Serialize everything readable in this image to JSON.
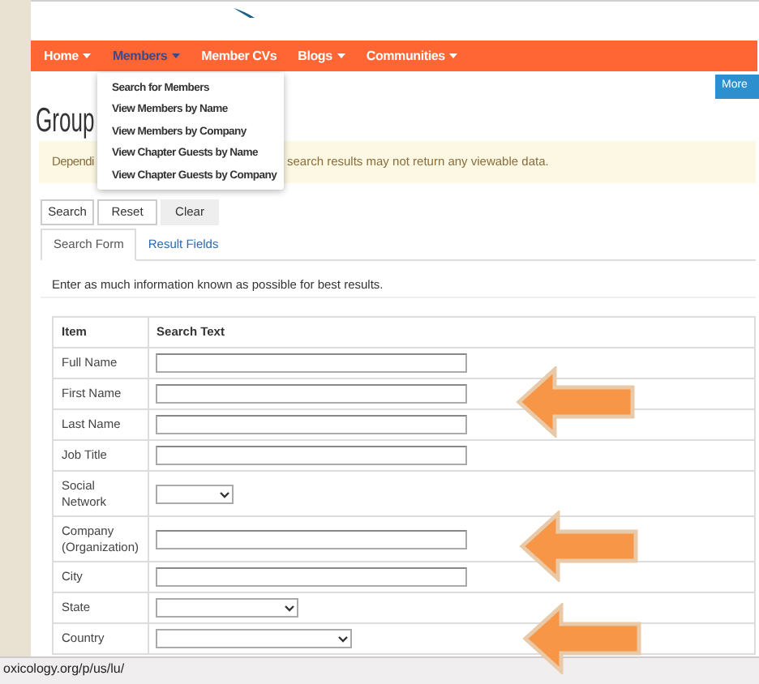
{
  "nav": {
    "items": [
      {
        "label": "Home",
        "caret": true,
        "selected": false
      },
      {
        "label": "Members",
        "caret": true,
        "selected": true
      },
      {
        "label": "Member CVs",
        "caret": false,
        "selected": false
      },
      {
        "label": "Blogs",
        "caret": true,
        "selected": false
      },
      {
        "label": "Communities",
        "caret": true,
        "selected": false
      }
    ]
  },
  "dropdown": {
    "items": [
      "Search for Members",
      "View Members by Name",
      "View Members by Company",
      "View Chapter Guests by Name",
      "View Chapter Guests by Company"
    ]
  },
  "more_button": "More",
  "heading": "Group",
  "alert": {
    "text_start": "Dependi",
    "text_end": "search results may not return any viewable data."
  },
  "buttons": [
    "Search",
    "Reset",
    "Clear"
  ],
  "tabs": [
    {
      "label": "Search Form",
      "selected": true
    },
    {
      "label": "Result Fields",
      "selected": false
    }
  ],
  "instructions": "Enter as much information known as possible for best results.",
  "table": {
    "columns": [
      "Item",
      "Search Text"
    ],
    "rows": [
      {
        "label": "Full Name",
        "kind": "text"
      },
      {
        "label": "First Name",
        "kind": "text"
      },
      {
        "label": "Last Name",
        "kind": "text"
      },
      {
        "label": "Job Title",
        "kind": "text"
      },
      {
        "label": "Social Network",
        "kind": "narrowselect"
      },
      {
        "label": "Company (Organization)",
        "kind": "text"
      },
      {
        "label": "City",
        "kind": "text"
      },
      {
        "label": "State",
        "kind": "select"
      },
      {
        "label": "Country",
        "kind": "wideselect"
      }
    ]
  },
  "status_bar": "oxicology.org/p/us/lu/"
}
